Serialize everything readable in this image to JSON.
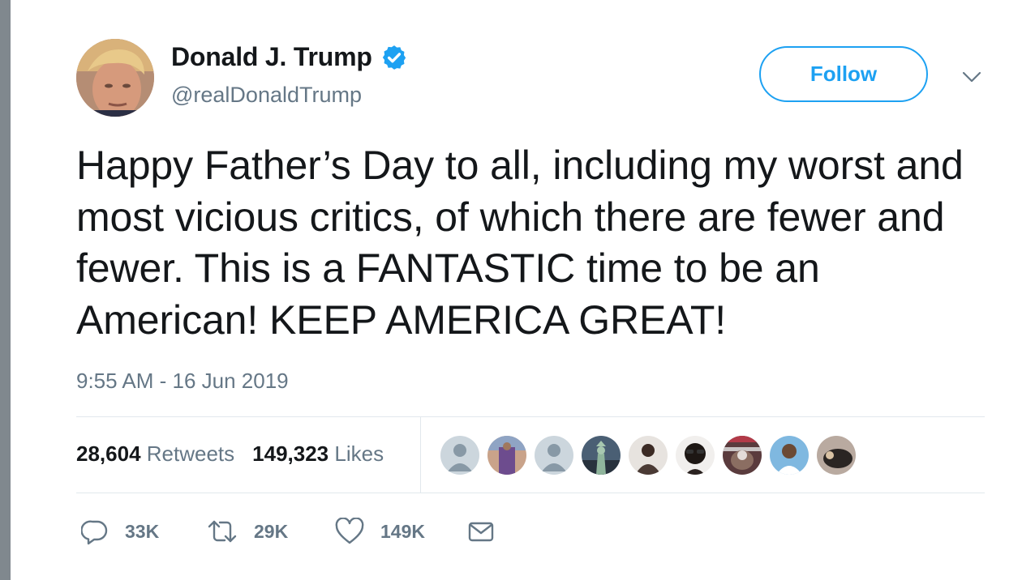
{
  "tweet": {
    "author": {
      "name": "Donald J. Trump",
      "handle": "@realDonaldTrump",
      "verified": true
    },
    "follow_label": "Follow",
    "text": "Happy Father’s Day to all, including my worst and most vicious critics, of which there are fewer and fewer. This is a FANTASTIC time to be an American! KEEP AMERICA GREAT!",
    "timestamp": "9:55 AM - 16 Jun 2019",
    "stats": {
      "retweets": "28,604",
      "retweets_label": "Retweets",
      "likes": "149,323",
      "likes_label": "Likes"
    },
    "actions": {
      "replies": "33K",
      "retweets": "29K",
      "likes": "149K"
    }
  },
  "colors": {
    "accent": "#1da1f2",
    "secondary_text": "#657786",
    "primary_text": "#14171a",
    "divider": "#e1e8ed"
  },
  "icons": [
    "verified-badge-icon",
    "chevron-down-icon",
    "reply-icon",
    "retweet-icon",
    "like-icon",
    "direct-message-icon"
  ]
}
